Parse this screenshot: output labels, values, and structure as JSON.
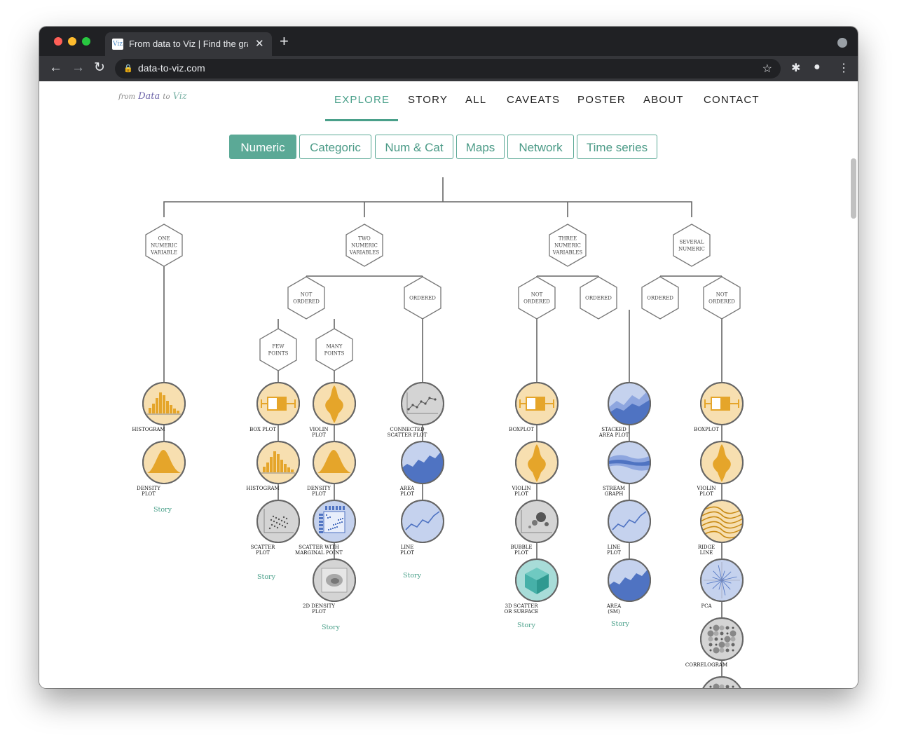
{
  "browser": {
    "tab_title": "From data to Viz | Find the graphic you need",
    "favicon_text": "Viz",
    "new_tab_label": "+",
    "close_label": "✕",
    "url": "data-to-viz.com"
  },
  "site": {
    "logo": {
      "part1": "from",
      "part2": "Data",
      "part3": "to",
      "part4": "Viz"
    },
    "nav": [
      "EXPLORE",
      "STORY",
      "ALL",
      "CAVEATS",
      "POSTER",
      "ABOUT",
      "CONTACT"
    ],
    "active_nav": "EXPLORE",
    "filters": [
      "Numeric",
      "Categoric",
      "Num & Cat",
      "Maps",
      "Network",
      "Time series"
    ],
    "active_filter": "Numeric"
  },
  "tree": {
    "decisions": {
      "one": [
        "ONE",
        "NUMERIC",
        "VARIABLE"
      ],
      "two": [
        "TWO",
        "NUMERIC",
        "VARIABLES"
      ],
      "three": [
        "THREE",
        "NUMERIC",
        "VARIABLES"
      ],
      "several": [
        "SEVERAL",
        "NUMERIC"
      ],
      "two_not_ordered": [
        "NOT",
        "ORDERED"
      ],
      "two_ordered": [
        "ORDERED"
      ],
      "few_points": [
        "FEW",
        "POINTS"
      ],
      "many_points": [
        "MANY",
        "POINTS"
      ],
      "three_not_ordered": [
        "NOT",
        "ORDERED"
      ],
      "three_ordered": [
        "ORDERED"
      ],
      "several_ordered": [
        "ORDERED"
      ],
      "several_not_ordered": [
        "NOT",
        "ORDERED"
      ]
    },
    "charts": {
      "histogram_1": [
        "HISTOGRAM"
      ],
      "density_1": [
        "DENSITY",
        "PLOT"
      ],
      "boxplot_few": [
        "BOX PLOT"
      ],
      "histogram_few": [
        "HISTOGRAM"
      ],
      "scatter_few": [
        "SCATTER",
        "PLOT"
      ],
      "violin_many": [
        "VIOLIN",
        "PLOT"
      ],
      "density_many": [
        "DENSITY",
        "PLOT"
      ],
      "scatter_marginal": [
        "SCATTER WITH",
        "MARGINAL POINT"
      ],
      "density2d": [
        "2D DENSITY",
        "PLOT"
      ],
      "connected_scatter": [
        "CONNECTED",
        "SCATTER PLOT"
      ],
      "area_two": [
        "AREA",
        "PLOT"
      ],
      "line_two": [
        "LINE",
        "PLOT"
      ],
      "boxplot_three": [
        "BOXPLOT"
      ],
      "violin_three": [
        "VIOLIN",
        "PLOT"
      ],
      "bubble": [
        "BUBBLE",
        "PLOT"
      ],
      "scatter3d": [
        "3D SCATTER",
        "OR SURFACE"
      ],
      "stacked_area": [
        "STACKED",
        "AREA PLOT"
      ],
      "stream": [
        "STREAM",
        "GRAPH"
      ],
      "line_ord": [
        "LINE",
        "PLOT"
      ],
      "area_sm": [
        "AREA",
        "(SM)"
      ],
      "boxplot_several": [
        "BOXPLOT"
      ],
      "violin_several": [
        "VIOLIN",
        "PLOT"
      ],
      "ridge": [
        "RIDGE",
        "LINE"
      ],
      "pca": [
        "PCA"
      ],
      "correlogram": [
        "CORRELOGRAM"
      ]
    },
    "story_label": "Story"
  },
  "colors": {
    "accent": "#4aa08a",
    "orange_fill": "#f7dfb0",
    "orange_mark": "#e5a52a",
    "blue_fill": "#c5d2ee",
    "blue_mark": "#4f73c2",
    "grey_fill": "#d4d4d4",
    "teal_fill": "#a8dcd8"
  }
}
